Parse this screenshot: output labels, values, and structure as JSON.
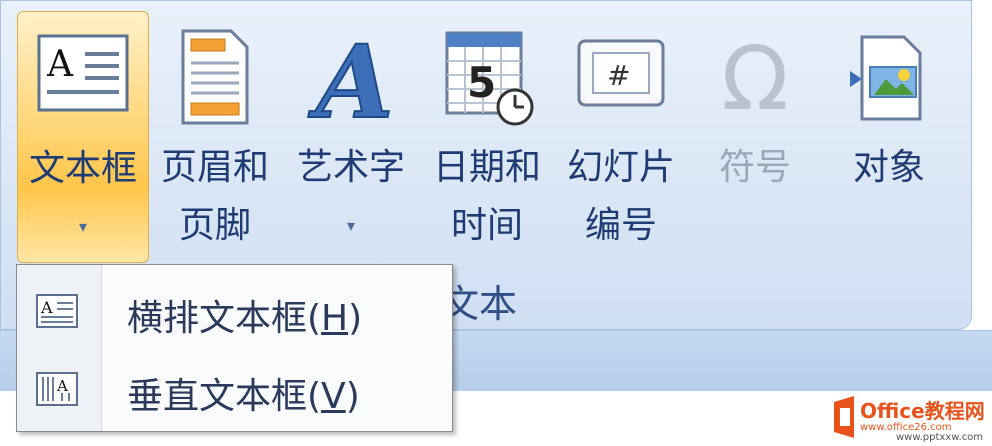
{
  "ribbon": {
    "group_label": "文本",
    "buttons": [
      {
        "line1": "文本框",
        "line2": "▾",
        "icon": "textbox-icon",
        "state": "active"
      },
      {
        "line1": "页眉和",
        "line2": "页脚",
        "icon": "header-footer-icon"
      },
      {
        "line1": "艺术字",
        "line2": "▾",
        "icon": "wordart-icon"
      },
      {
        "line1": "日期和",
        "line2": "时间",
        "icon": "date-time-icon",
        "icon_text": "5"
      },
      {
        "line1": "幻灯片",
        "line2": "编号",
        "icon": "slide-number-icon",
        "icon_text": "#"
      },
      {
        "line1": "符号",
        "line2": "",
        "icon": "symbol-icon",
        "icon_text": "Ω",
        "state": "disabled"
      },
      {
        "line1": "对象",
        "line2": "",
        "icon": "object-icon"
      }
    ]
  },
  "menu": {
    "items": [
      {
        "label_main": "横排文本框(",
        "accel": "H",
        "label_end": ")",
        "icon": "horizontal-textbox-icon"
      },
      {
        "label_main": "垂直文本框(",
        "accel": "V",
        "label_end": ")",
        "icon": "vertical-textbox-icon"
      }
    ]
  },
  "watermark": {
    "brand": "Office教程网",
    "url": "www.office26.com",
    "url2": "www.pptxxw.com"
  },
  "colors": {
    "accent": "#ffc54a",
    "ribbon": "#dbe7f6",
    "text": "#1f3b73",
    "logo": "#e8531c"
  }
}
